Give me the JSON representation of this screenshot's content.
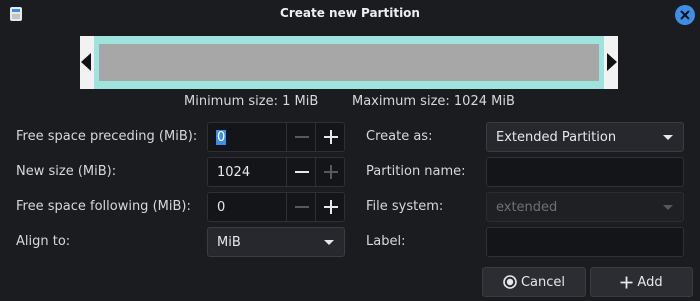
{
  "window": {
    "title": "Create new Partition"
  },
  "info": {
    "min_size": "Minimum size: 1 MiB",
    "max_size": "Maximum size: 1024 MiB"
  },
  "fields": {
    "free_before": {
      "label": "Free space preceding (MiB):",
      "value": "0"
    },
    "new_size": {
      "label": "New size (MiB):",
      "value": "1024"
    },
    "free_after": {
      "label": "Free space following (MiB):",
      "value": "0"
    },
    "align": {
      "label": "Align to:",
      "value": "MiB"
    },
    "create_as": {
      "label": "Create as:",
      "value": "Extended Partition"
    },
    "partition_name": {
      "label": "Partition name:",
      "value": ""
    },
    "file_system": {
      "label": "File system:",
      "value": "extended"
    },
    "fs_label": {
      "label": "Label:",
      "value": ""
    }
  },
  "buttons": {
    "cancel": "Cancel",
    "add": "Add"
  },
  "colors": {
    "accent": "#3d8ee6",
    "partition_border": "#9fe3de",
    "partition_fill": "#a7a7a7"
  },
  "icons": {
    "close": "close-icon",
    "cancel": "cancel-icon",
    "add": "plus-icon",
    "app": "gparted-app-icon"
  }
}
